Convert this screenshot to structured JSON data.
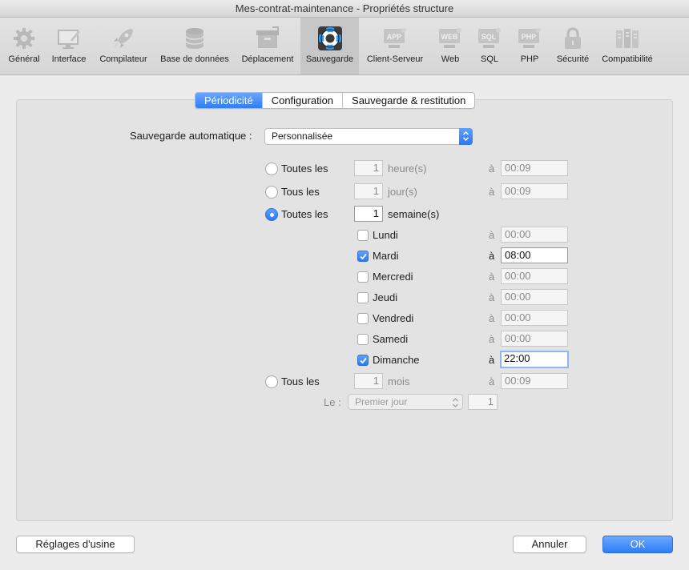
{
  "window": {
    "title": "Mes-contrat-maintenance - Propriétés structure"
  },
  "toolbar": {
    "items": [
      {
        "label": "Général",
        "icon": "gear-icon"
      },
      {
        "label": "Interface",
        "icon": "interface-icon"
      },
      {
        "label": "Compilateur",
        "icon": "rocket-icon"
      },
      {
        "label": "Base de données",
        "icon": "database-icon"
      },
      {
        "label": "Déplacement",
        "icon": "box-icon"
      },
      {
        "label": "Sauvegarde",
        "icon": "lifebuoy-icon",
        "selected": true
      },
      {
        "label": "Client-Serveur",
        "icon": "app-server-icon",
        "badge": "APP"
      },
      {
        "label": "Web",
        "icon": "web-server-icon",
        "badge": "WEB"
      },
      {
        "label": "SQL",
        "icon": "sql-server-icon",
        "badge": "SQL"
      },
      {
        "label": "PHP",
        "icon": "php-server-icon",
        "badge": "PHP"
      },
      {
        "label": "Sécurité",
        "icon": "lock-icon"
      },
      {
        "label": "Compatibilité",
        "icon": "compatibility-icon"
      }
    ]
  },
  "tabs": [
    {
      "label": "Périodicité",
      "active": true
    },
    {
      "label": "Configuration",
      "active": false
    },
    {
      "label": "Sauvegarde & restitution",
      "active": false
    }
  ],
  "auto_backup": {
    "label": "Sauvegarde automatique :",
    "value": "Personnalisée"
  },
  "periodicity": {
    "hours": {
      "label": "Toutes les",
      "value": "1",
      "unit": "heure(s)",
      "at": "à",
      "time": "00:09",
      "selected": false
    },
    "days": {
      "label": "Tous les",
      "value": "1",
      "unit": "jour(s)",
      "at": "à",
      "time": "00:09",
      "selected": false
    },
    "weeks": {
      "label": "Toutes les",
      "value": "1",
      "unit": "semaine(s)",
      "selected": true
    },
    "weekdays": [
      {
        "label": "Lundi",
        "checked": false,
        "at": "à",
        "time": "00:00"
      },
      {
        "label": "Mardi",
        "checked": true,
        "at": "à",
        "time": "08:00"
      },
      {
        "label": "Mercredi",
        "checked": false,
        "at": "à",
        "time": "00:00"
      },
      {
        "label": "Jeudi",
        "checked": false,
        "at": "à",
        "time": "00:00"
      },
      {
        "label": "Vendredi",
        "checked": false,
        "at": "à",
        "time": "00:00"
      },
      {
        "label": "Samedi",
        "checked": false,
        "at": "à",
        "time": "00:00"
      },
      {
        "label": "Dimanche",
        "checked": true,
        "at": "à",
        "time": "22:00"
      }
    ],
    "months": {
      "label": "Tous les",
      "value": "1",
      "unit": "mois",
      "at": "à",
      "time": "00:09",
      "selected": false
    },
    "day_of_month": {
      "label": "Le :",
      "value": "Premier jour",
      "number": "1"
    }
  },
  "buttons": {
    "factory": "Réglages d'usine",
    "cancel": "Annuler",
    "ok": "OK"
  },
  "colors": {
    "accent": "#2f7cf5",
    "selected_toolbar": "#c7c7c7"
  }
}
